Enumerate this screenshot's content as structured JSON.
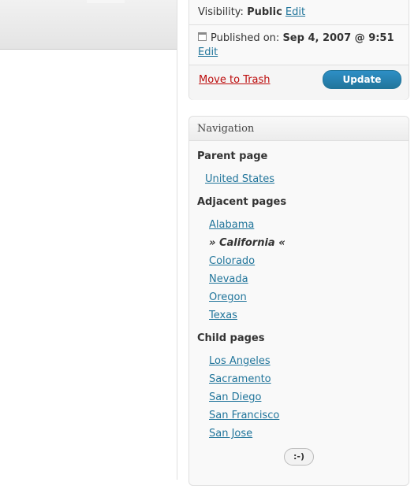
{
  "publish": {
    "visibility_label": "Visibility:",
    "visibility_value": "Public",
    "visibility_edit": "Edit",
    "published_label": "Published on:",
    "published_value": "Sep 4, 2007 @ 9:51",
    "published_edit": "Edit",
    "trash_label": "Move to Trash",
    "update_label": "Update"
  },
  "navigation": {
    "title": "Navigation",
    "parent_heading": "Parent page",
    "parent_link": "United States",
    "adjacent_heading": "Adjacent pages",
    "adjacent": [
      "Alabama",
      "California",
      "Colorado",
      "Nevada",
      "Oregon",
      "Texas"
    ],
    "current_prefix": "»",
    "current_suffix": "«",
    "child_heading": "Child pages",
    "children": [
      "Los Angeles",
      "Sacramento",
      "San Diego",
      "San Francisco",
      "San Jose"
    ],
    "smile_label": ":-)"
  },
  "colors": {
    "link": "#21759b",
    "trash": "#bc0b0b",
    "update_button": "#21759b"
  },
  "icons": {
    "published": "calendar-icon"
  }
}
